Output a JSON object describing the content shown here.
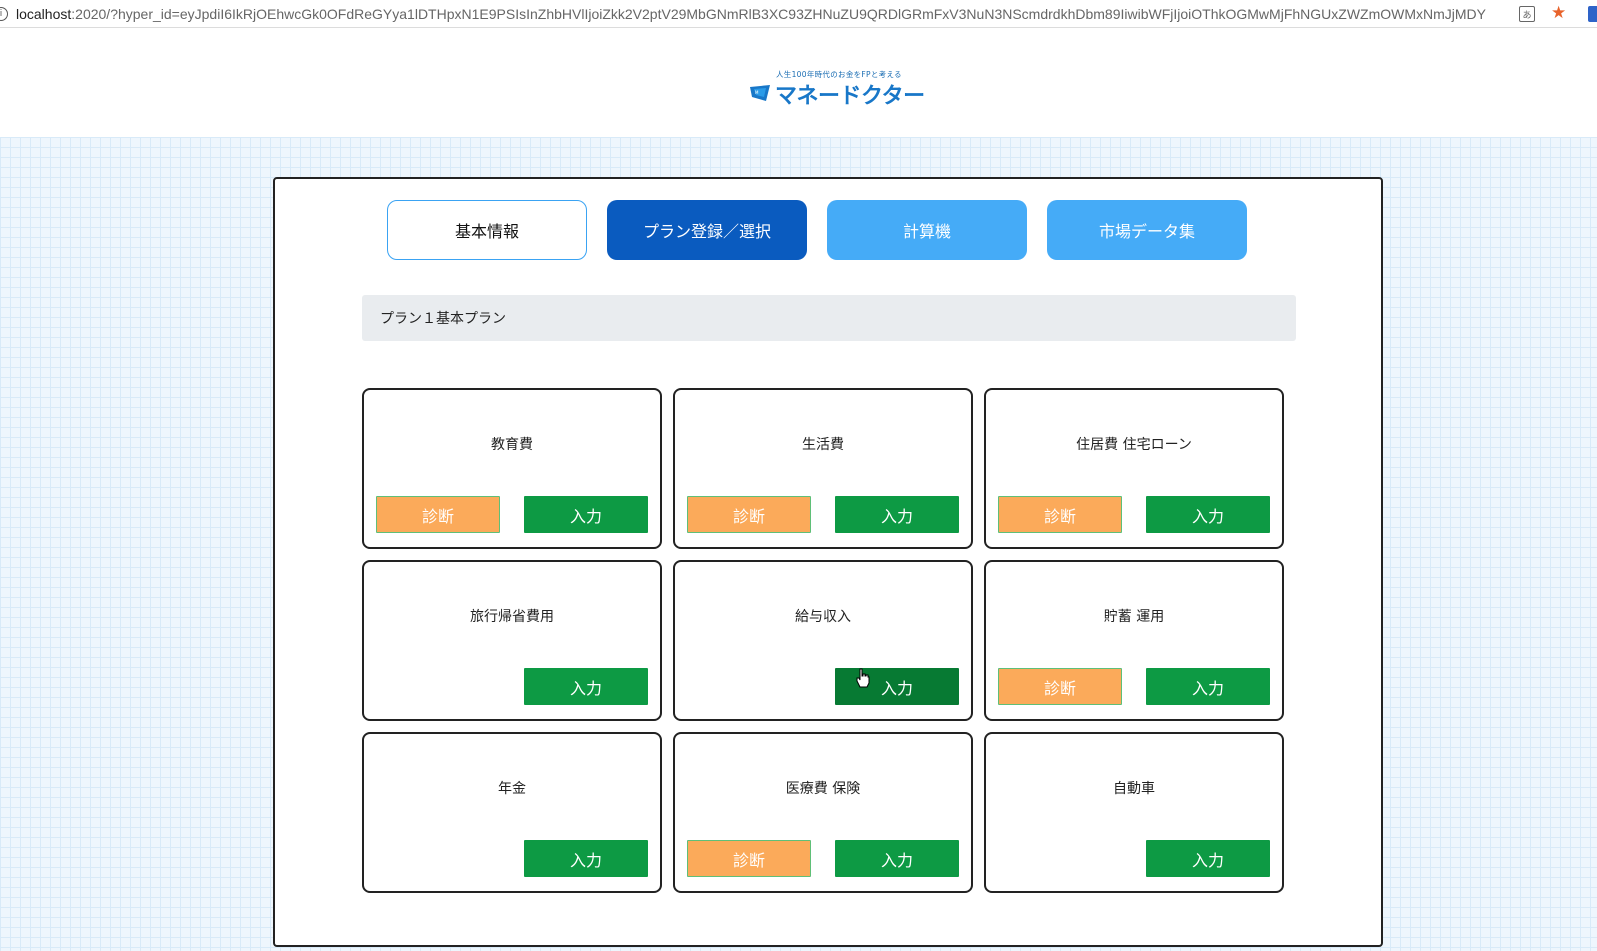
{
  "browser": {
    "url_host": "localhost",
    "url_rest": ":2020/?hyper_id=eyJpdiI6IkRjOEhwcGk0OFdReGYya1lDTHpxN1E9PSIsInZhbHVlIjoiZkk2V2ptV29MbGNmRlB3XC93ZHNuZU9QRDlGRmFxV3NuN3NScmdrdkhDbm89IiwibWFjIjoiOThkOGMwMjFhNGUxZWZmOWMxNmJjMDY1..."
  },
  "logo": {
    "tagline": "人生100年時代のお金をFPと考える",
    "name": "マネードクター"
  },
  "tabs": [
    {
      "label": "基本情報"
    },
    {
      "label": "プラン登録／選択"
    },
    {
      "label": "計算機"
    },
    {
      "label": "市場データ集"
    }
  ],
  "plan_bar": {
    "label": "プラン１基本プラン"
  },
  "buttons": {
    "diagnose": "診断",
    "input": "入力"
  },
  "cards": [
    {
      "title": "教育費"
    },
    {
      "title": "生活費"
    },
    {
      "title": "住居費 住宅ローン"
    },
    {
      "title": "旅行帰省費用"
    },
    {
      "title": "給与収入"
    },
    {
      "title": "貯蓄 運用"
    },
    {
      "title": "年金"
    },
    {
      "title": "医療費 保険"
    },
    {
      "title": "自動車"
    }
  ],
  "colors": {
    "tab_active": "#0a5bbf",
    "tab_inactive": "#45abf7",
    "diagnose_button": "#fbaa5a",
    "input_button": "#0d9a44"
  }
}
